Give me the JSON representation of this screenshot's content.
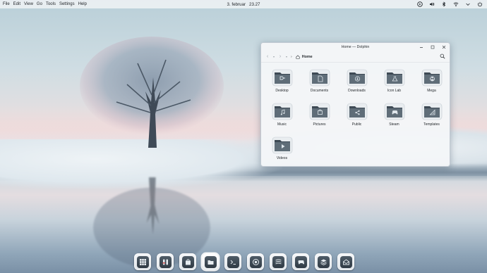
{
  "menu_bar": {
    "items": [
      "File",
      "Edit",
      "View",
      "Go",
      "Tools",
      "Settings",
      "Help"
    ]
  },
  "clock": {
    "date": "3. februar",
    "time": "23.27"
  },
  "tray": [
    "media-icon",
    "volume-icon",
    "bluetooth-icon",
    "wifi-icon",
    "chevron-down-icon",
    "power-icon"
  ],
  "window": {
    "title": "Home — Dolphin",
    "location": "Home",
    "items": [
      {
        "label": "Desktop",
        "icon": "desktop-icon"
      },
      {
        "label": "Documents",
        "icon": "document-icon"
      },
      {
        "label": "Downloads",
        "icon": "download-icon"
      },
      {
        "label": "Icon Lab",
        "icon": "flask-icon"
      },
      {
        "label": "Mega",
        "icon": "mega-icon"
      },
      {
        "label": "Music",
        "icon": "music-icon"
      },
      {
        "label": "Pictures",
        "icon": "pictures-icon"
      },
      {
        "label": "Public",
        "icon": "share-icon"
      },
      {
        "label": "Steam",
        "icon": "gamepad-icon"
      },
      {
        "label": "Templates",
        "icon": "templates-icon"
      },
      {
        "label": "Videos",
        "icon": "video-icon"
      }
    ]
  },
  "dock": [
    {
      "icon": "app-grid-icon"
    },
    {
      "icon": "settings-icon"
    },
    {
      "icon": "software-store-icon"
    },
    {
      "icon": "file-manager-icon",
      "active": true
    },
    {
      "icon": "terminal-icon"
    },
    {
      "icon": "browser-icon"
    },
    {
      "icon": "podcast-icon"
    },
    {
      "icon": "gamepad-icon"
    },
    {
      "icon": "layers-icon"
    },
    {
      "icon": "mail-icon"
    }
  ],
  "colors": {
    "folder_dark": "#3d4954",
    "folder_light": "#7b8a96",
    "accent": "#5f7f98"
  }
}
